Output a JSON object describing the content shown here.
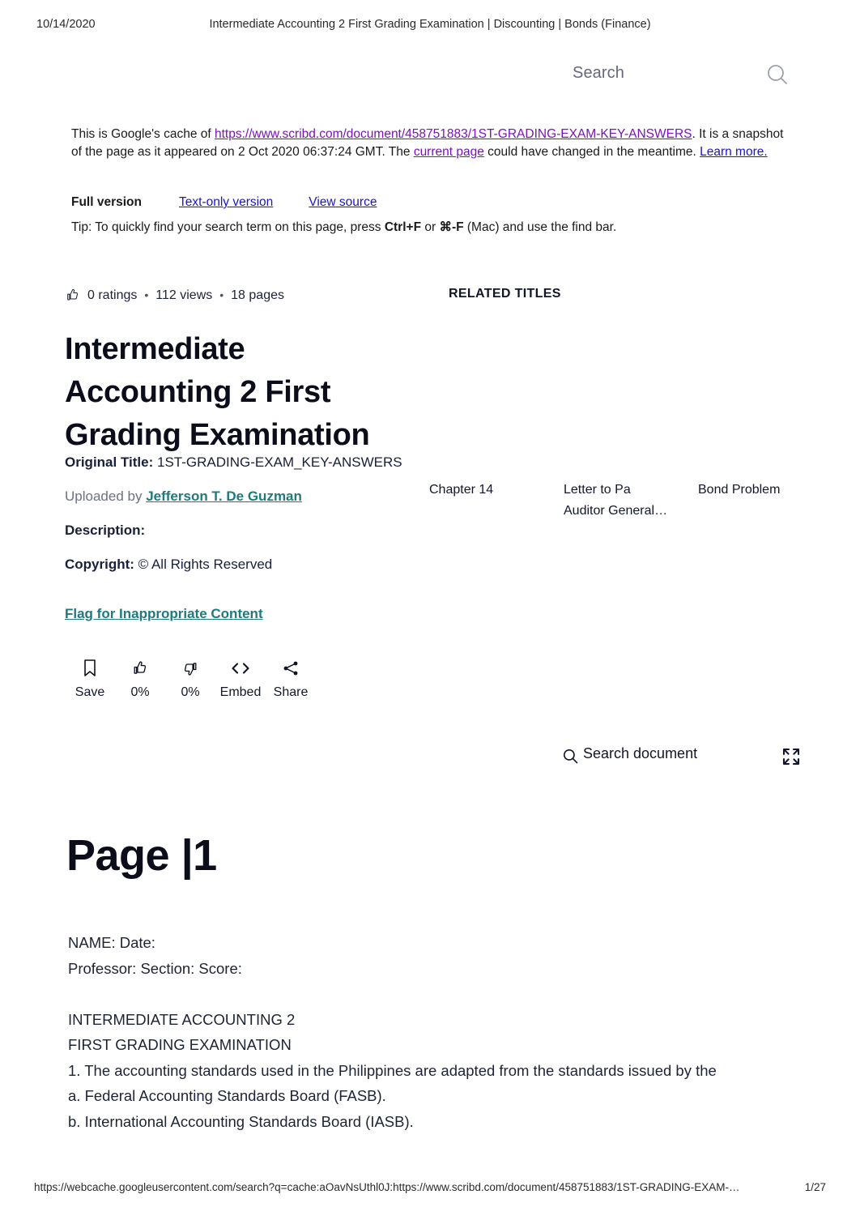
{
  "print_header": {
    "date": "10/14/2020",
    "title": "Intermediate Accounting 2 First Grading Examination | Discounting | Bonds (Finance)"
  },
  "top_search": {
    "placeholder": "Search",
    "icon": "search-icon"
  },
  "cache_banner": {
    "intro": "This is Google's cache of ",
    "cached_url": "https://www.scribd.com/document/458751883/1ST-GRADING-EXAM-KEY-ANSWERS",
    "after_url": ". It is a snapshot of the page as it appeared on 2 Oct 2020 06:37:24 GMT. The ",
    "current_page_link": "current page",
    "after_current": " could have changed in the meantime. ",
    "learn_more_link": "Learn more.",
    "versions": [
      {
        "label": "Full version",
        "current": true
      },
      {
        "label": "Text-only version",
        "current": false
      },
      {
        "label": "View source",
        "current": false
      }
    ],
    "tip_prefix": "Tip: To quickly find your search term on this page, press ",
    "tip_key1": "Ctrl+F",
    "tip_or": " or ",
    "tip_key2": "⌘-F",
    "tip_suffix": " (Mac) and use the find bar.",
    "link_color_purple": "#7a12b8",
    "link_color_blue": "#1a16c4"
  },
  "document": {
    "stats": {
      "ratings": "0 ratings",
      "views": "112 views",
      "pages": "18 pages",
      "separator": "•",
      "rating_icon": "thumbs-up-icon"
    },
    "title": "Intermediate Accounting 2 First Grading Examination",
    "original_title_label": "Original Title:",
    "original_title_value": " 1ST-GRADING-EXAM_KEY-ANSWERS",
    "uploaded_by_label": "Uploaded by ",
    "uploaded_by_value": "Jefferson T. De Guzman",
    "description_label": "Description:",
    "copyright_label": "Copyright:",
    "copyright_value": " © All Rights Reserved",
    "flag_link": "Flag for Inappropriate Content",
    "accent_teal": "#1f7a7d"
  },
  "actions": [
    {
      "label": "Save",
      "icon": "bookmark-icon"
    },
    {
      "label": "0%",
      "icon": "thumbs-up-icon"
    },
    {
      "label": "0%",
      "icon": "thumbs-down-icon"
    },
    {
      "label": "Embed",
      "icon": "code-brackets-icon"
    },
    {
      "label": "Share",
      "icon": "share-icon"
    }
  ],
  "related": {
    "heading": "RELATED TITLES",
    "items": [
      {
        "title_line1": "Chapter 14",
        "title_line2": ""
      },
      {
        "title_line1": "Letter to Pa",
        "title_line2": "Auditor General…"
      },
      {
        "title_line1": "Bond Problem",
        "title_line2": ""
      }
    ]
  },
  "doc_toolbar": {
    "search_document_label": "Search document",
    "search_icon": "search-icon",
    "expand_icon": "fullscreen-expand-icon"
  },
  "page_view": {
    "page_label": "Page |1",
    "lines": [
      "NAME: Date:",
      "Professor: Section: Score:",
      "",
      "INTERMEDIATE ACCOUNTING 2",
      "FIRST GRADING EXAMINATION",
      "1. The accounting standards used in the Philippines are adapted from the standards issued by the",
      "a. Federal Accounting Standards Board (FASB).",
      "b. International Accounting Standards Board (IASB)."
    ]
  },
  "print_footer": {
    "url": "https://webcache.googleusercontent.com/search?q=cache:aOavNsUthl0J:https://www.scribd.com/document/458751883/1ST-GRADING-EXAM-…",
    "page_number": "1/27"
  }
}
